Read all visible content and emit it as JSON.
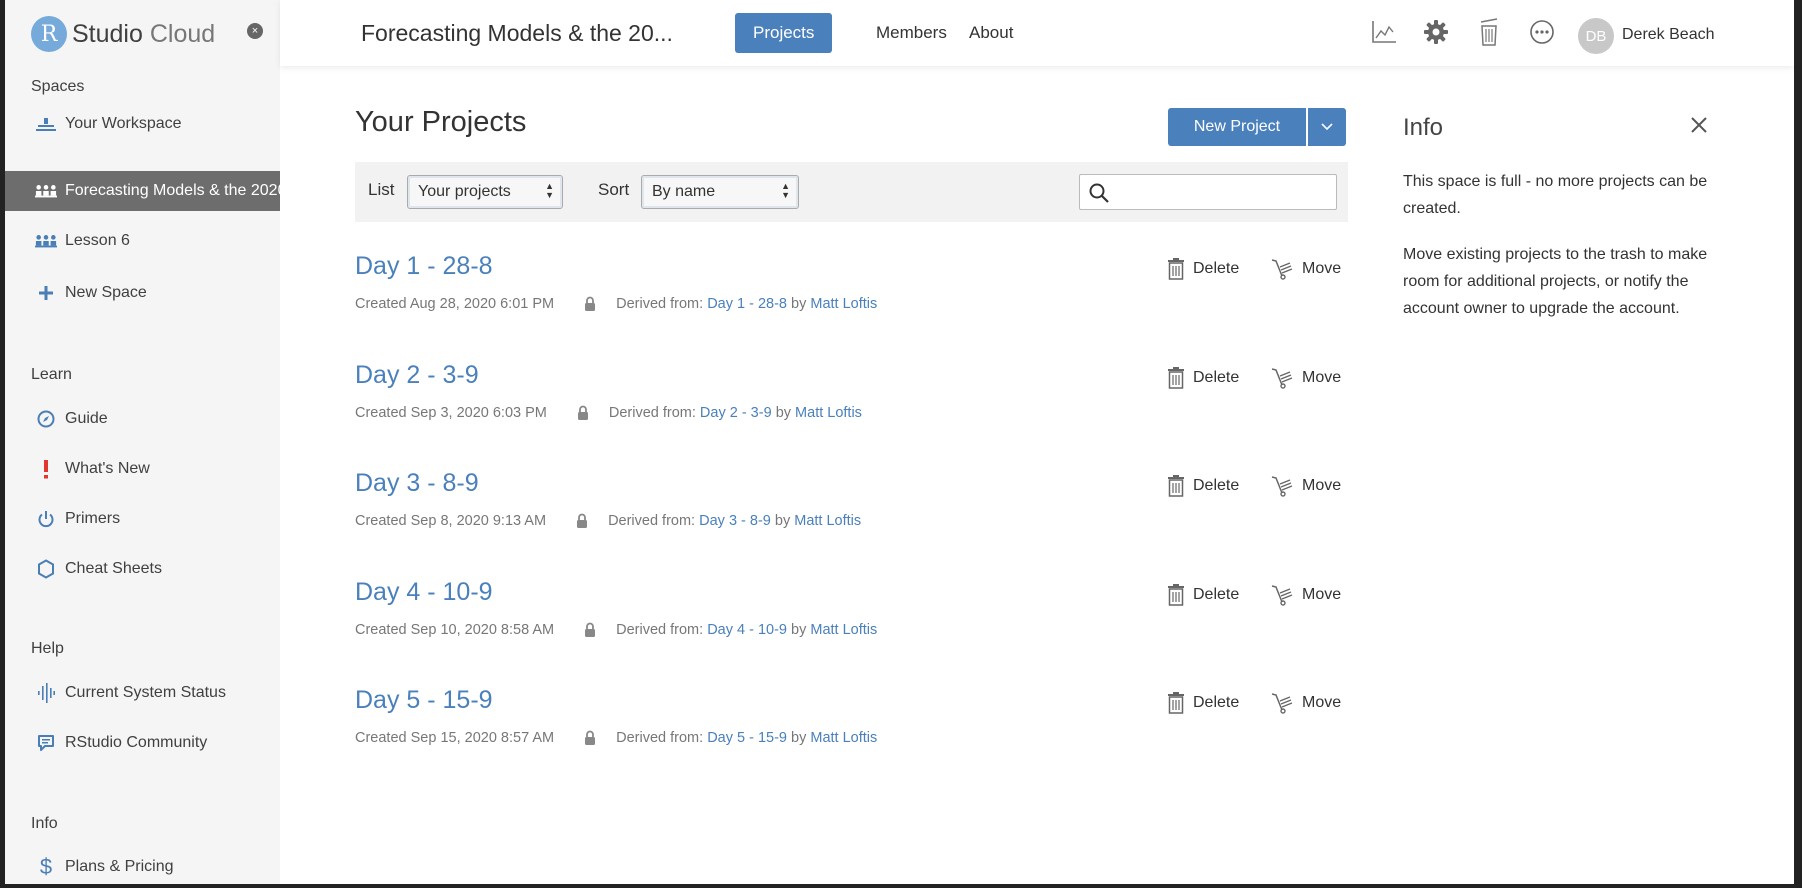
{
  "brand": {
    "logo_letter": "R",
    "name_bold": "Studio",
    "name_thin": " Cloud",
    "close_glyph": "×"
  },
  "sidebar": {
    "spaces_heading": "Spaces",
    "spaces": [
      {
        "label": "Your Workspace",
        "icon": "workspace-icon"
      },
      {
        "label": "Forecasting Models & the 2020",
        "icon": "group-icon"
      },
      {
        "label": "Lesson 6",
        "icon": "group-icon"
      },
      {
        "label": "New Space",
        "icon": "plus-icon"
      }
    ],
    "learn_heading": "Learn",
    "learn": [
      {
        "label": "Guide",
        "icon": "compass-icon"
      },
      {
        "label": "What's New",
        "icon": "exclamation-icon"
      },
      {
        "label": "Primers",
        "icon": "power-icon"
      },
      {
        "label": "Cheat Sheets",
        "icon": "hexagon-icon"
      }
    ],
    "help_heading": "Help",
    "help": [
      {
        "label": "Current System Status",
        "icon": "pulse-icon"
      },
      {
        "label": "RStudio Community",
        "icon": "chat-icon"
      }
    ],
    "info_heading": "Info",
    "info": [
      {
        "label": "Plans & Pricing",
        "icon": "dollar-icon"
      }
    ]
  },
  "header": {
    "space_title": "Forecasting Models & the 20...",
    "tabs": [
      {
        "label": "Projects",
        "active": true
      },
      {
        "label": "Members",
        "active": false
      },
      {
        "label": "About",
        "active": false
      }
    ],
    "user_initials": "DB",
    "user_name": "Derek Beach"
  },
  "main": {
    "title": "Your Projects",
    "new_project_label": "New Project",
    "list_label": "List",
    "list_value": "Your projects",
    "sort_label": "Sort",
    "sort_value": "By name",
    "search_placeholder": "",
    "delete_label": "Delete",
    "move_label": "Move",
    "derived_label": "Derived from:",
    "by_label": "by",
    "projects": [
      {
        "name": "Day 1 - 28-8",
        "created": "Created Aug 28, 2020 6:01 PM",
        "derived": "Day 1 - 28-8",
        "author": "Matt Loftis"
      },
      {
        "name": "Day 2 - 3-9",
        "created": "Created Sep 3, 2020 6:03 PM",
        "derived": "Day 2 - 3-9",
        "author": "Matt Loftis"
      },
      {
        "name": "Day 3 - 8-9",
        "created": "Created Sep 8, 2020 9:13 AM",
        "derived": "Day 3 - 8-9",
        "author": "Matt Loftis"
      },
      {
        "name": "Day 4 - 10-9",
        "created": "Created Sep 10, 2020 8:58 AM",
        "derived": "Day 4 - 10-9",
        "author": "Matt Loftis"
      },
      {
        "name": "Day 5 - 15-9",
        "created": "Created Sep 15, 2020 8:57 AM",
        "derived": "Day 5 - 15-9",
        "author": "Matt Loftis"
      }
    ]
  },
  "info": {
    "title": "Info",
    "paragraph_1": "This space is full - no more projects can be created.",
    "paragraph_2": "Move existing projects to the trash to make room for additional projects, or notify the account owner to upgrade the account."
  },
  "colors": {
    "accent": "#4a80bb",
    "sidebar_bg": "#f5f5f5",
    "active_item": "#6d6d6d"
  }
}
